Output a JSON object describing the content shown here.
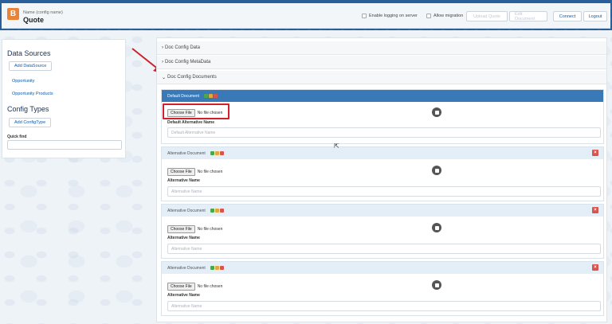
{
  "header": {
    "logo_glyph": "B",
    "config_subtitle": "Name (config name)",
    "config_title": "Quote",
    "enable_logging_label": "Enable logging on server",
    "allow_migration_label": "Allow migration",
    "upload_button": "Upload Quote",
    "edit_button": "Edit Document",
    "connect_button": "Connect",
    "logout_button": "Logout"
  },
  "sidebar": {
    "data_sources_title": "Data Sources",
    "add_datasource_button": "Add DataSource",
    "datasources": [
      "Opportunity",
      "Opportunity Products"
    ],
    "config_types_title": "Config Types",
    "add_configtype_button": "Add ConfigType",
    "quick_find_label": "Quick find"
  },
  "sections": [
    {
      "label": "Doc Config Data",
      "chevron": "›"
    },
    {
      "label": "Doc Config MetaData",
      "chevron": "›"
    },
    {
      "label": "Doc Config Documents",
      "chevron": "⌄"
    }
  ],
  "documents": [
    {
      "title": "Default Document",
      "choose_file": "Choose File",
      "no_file": "No file chosen",
      "field_label": "Default Alternative Name",
      "placeholder": "Default Alternative Name"
    },
    {
      "title": "Alternative Document",
      "choose_file": "Choose File",
      "no_file": "No file chosen",
      "field_label": "Alternative Name",
      "placeholder": "Alternative Name",
      "delete": "×"
    },
    {
      "title": "Alternative Document",
      "choose_file": "Choose File",
      "no_file": "No file chosen",
      "field_label": "Alternative Name",
      "placeholder": "Alternative Name",
      "delete": "×"
    },
    {
      "title": "Alternative Document",
      "choose_file": "Choose File",
      "no_file": "No file chosen",
      "field_label": "Alternative Name",
      "placeholder": "Alternative Name",
      "delete": "×"
    }
  ],
  "colors": {
    "accent_blue": "#3a79b8",
    "highlight_red": "#d0202a",
    "link_blue": "#0b5cad"
  },
  "icons": {
    "logo": "app-logo-icon",
    "save": "save-icon",
    "delete": "close-icon",
    "cursor": "mouse-cursor-icon",
    "annotation": "red-arrow-icon"
  }
}
